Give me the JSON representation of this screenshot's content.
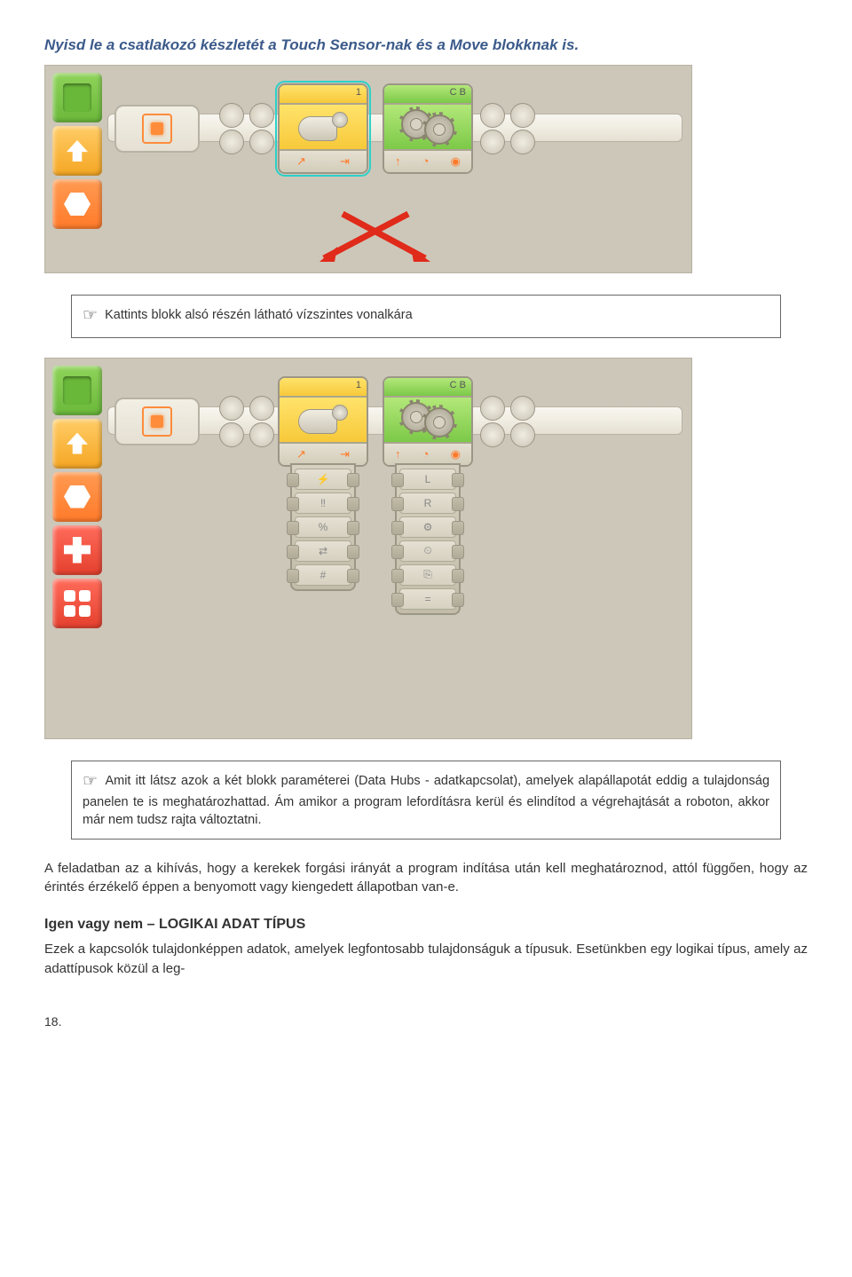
{
  "title": "Nyisd le a csatlakozó készletét a Touch Sensor-nak és a Move blokknak is.",
  "fig1": {
    "touch_port": "1",
    "move_port": "C B"
  },
  "callout1": {
    "hand": "☞",
    "text": "Kattints blokk alsó részén látható vízszintes vonalkára"
  },
  "fig2": {
    "touch_port": "1",
    "move_port": "C B",
    "hub_left": [
      "⚡",
      "‼",
      "%",
      "⇄",
      "#"
    ],
    "hub_right": [
      "L",
      "R",
      "⚙",
      "⏲",
      "⎘",
      "="
    ]
  },
  "callout2": {
    "hand": "☞",
    "text": "Amit itt látsz azok a két blokk paraméterei (Data Hubs - adatkapcsolat), amelyek alapállapotát eddig a tulajdonság panelen te is meghatározhattad. Ám amikor a program lefordításra kerül és elindítod a végrehajtását a roboton, akkor már nem tudsz rajta változtatni."
  },
  "paragraph": "A feladatban az a kihívás, hogy a kerekek forgási irányát a program indítása után kell meghatároznod, attól függően, hogy az érintés érzékelő éppen a benyomott vagy kiengedett állapotban van-e.",
  "section_head": "Igen vagy nem – LOGIKAI ADAT TÍPUS",
  "section_body": "Ezek a kapcsolók tulajdonképpen adatok, amelyek legfontosabb tulajdonságuk a típusuk. Esetünkben egy logikai típus, amely az adattípusok közül a leg-",
  "page_number": "18."
}
